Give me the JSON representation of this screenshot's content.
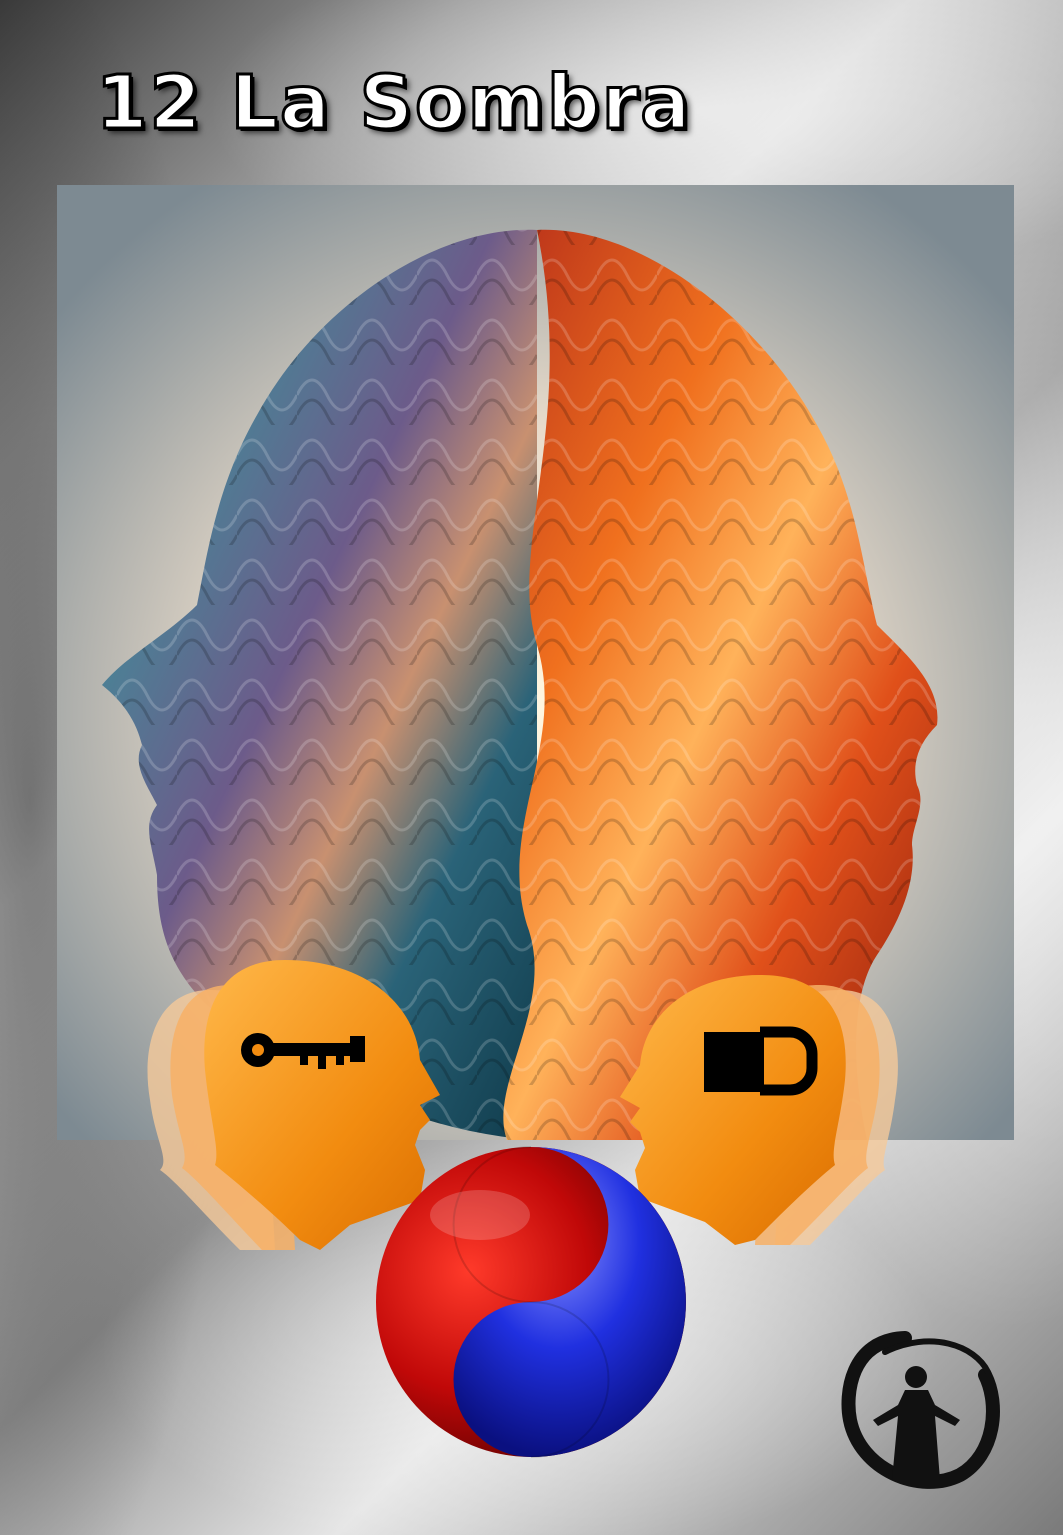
{
  "card": {
    "title": "12 La Sombra"
  },
  "icons": {
    "left_head_symbol": "key-icon",
    "right_head_symbol": "padlock-icon",
    "center_symbol": "yin-yang-sphere-icon",
    "corner_emblem": "enso-meditating-figure-icon"
  },
  "colors": {
    "blue_face": "#2c6b85",
    "red_face": "#d2461c",
    "head_orange": "#f39a1d",
    "sphere_red": "#c41010",
    "sphere_blue": "#1f2ee0"
  }
}
